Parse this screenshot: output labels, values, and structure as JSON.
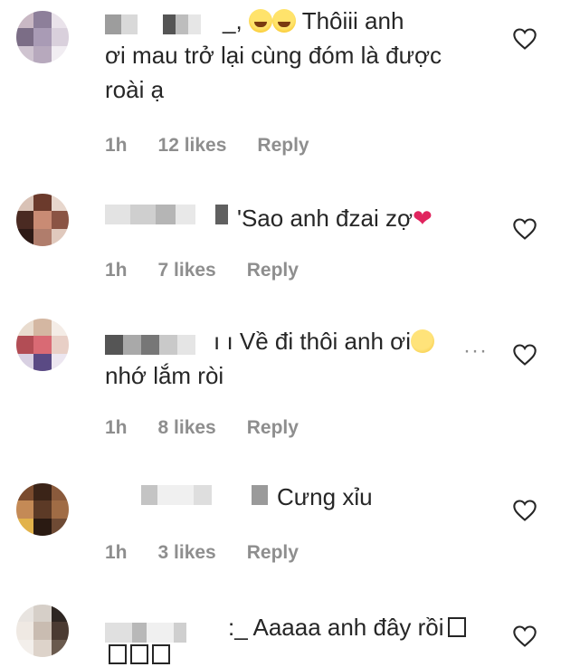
{
  "comments": [
    {
      "text": "Thôiii anh\nơi mau trở lại cùng đóm là được\nroài ạ",
      "meta": {
        "time": "1h",
        "likes": "12 likes",
        "reply": "Reply"
      },
      "prefix": "_,",
      "emoji": "laugh-emoji"
    },
    {
      "text": "Sao anh đzai zợ",
      "meta": {
        "time": "1h",
        "likes": "7 likes",
        "reply": "Reply"
      },
      "prefix": "'",
      "emoji": "red-heart-emoji"
    },
    {
      "text": "Về đi thôi anh ơi",
      "text2": "nhớ lắm ròi",
      "meta": {
        "time": "1h",
        "likes": "8 likes",
        "reply": "Reply"
      },
      "prefix": "ı ı",
      "more": "···",
      "emoji": "sleepy-emoji"
    },
    {
      "text": "Cưng xỉu",
      "meta": {
        "time": "1h",
        "likes": "3 likes",
        "reply": "Reply"
      }
    },
    {
      "text": "Aaaaa anh đây rồi",
      "prefix": ":_"
    }
  ],
  "colors": {
    "meta": "#8e8e8e",
    "text": "#262626",
    "heart": "#262626"
  }
}
